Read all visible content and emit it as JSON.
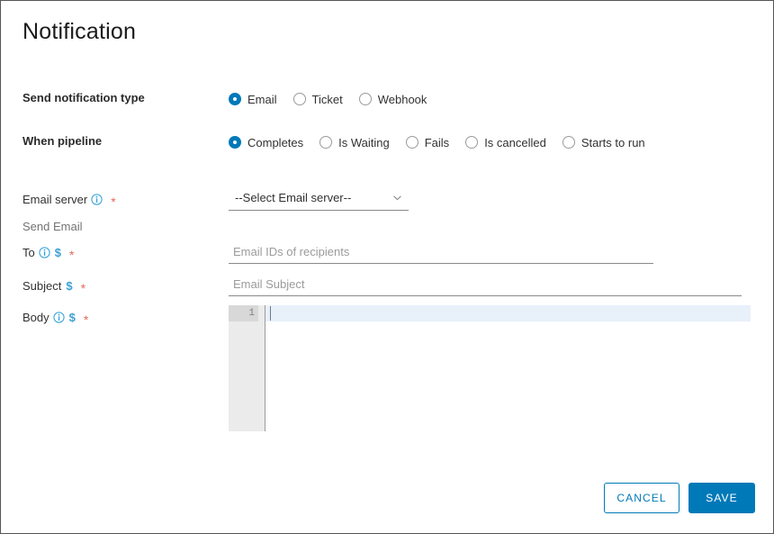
{
  "page": {
    "title": "Notification"
  },
  "notification_type": {
    "label": "Send notification type",
    "options": [
      {
        "label": "Email",
        "selected": true
      },
      {
        "label": "Ticket",
        "selected": false
      },
      {
        "label": "Webhook",
        "selected": false
      }
    ]
  },
  "when_pipeline": {
    "label": "When pipeline",
    "options": [
      {
        "label": "Completes",
        "selected": true
      },
      {
        "label": "Is Waiting",
        "selected": false
      },
      {
        "label": "Fails",
        "selected": false
      },
      {
        "label": "Is cancelled",
        "selected": false
      },
      {
        "label": "Starts to run",
        "selected": false
      }
    ]
  },
  "fields": {
    "email_server": {
      "label": "Email server",
      "required_marker": "*",
      "info_icon": "info-circle-icon",
      "selected_option": "--Select Email server--",
      "options": [
        "--Select Email server--"
      ],
      "chevron_icon": "chevron-down-icon"
    },
    "send_email": {
      "label": "Send Email"
    },
    "to": {
      "label": "To",
      "required_marker": "*",
      "info_icon": "info-circle-icon",
      "variable_token": "$",
      "value": "",
      "placeholder": "Email IDs of recipients"
    },
    "subject": {
      "label": "Subject",
      "required_marker": "*",
      "variable_token": "$",
      "value": "",
      "placeholder": "Email Subject"
    },
    "body": {
      "label": "Body",
      "required_marker": "*",
      "info_icon": "info-circle-icon",
      "variable_token": "$",
      "line_number": "1",
      "content": ""
    }
  },
  "footer": {
    "cancel_label": "CANCEL",
    "save_label": "SAVE"
  },
  "colors": {
    "accent": "#0079b8",
    "required_star": "#e06c5a",
    "variable_token": "#3b9fd4",
    "border": "#565656",
    "active_line": "#e8f0fa",
    "gutter": "#ebebeb"
  }
}
